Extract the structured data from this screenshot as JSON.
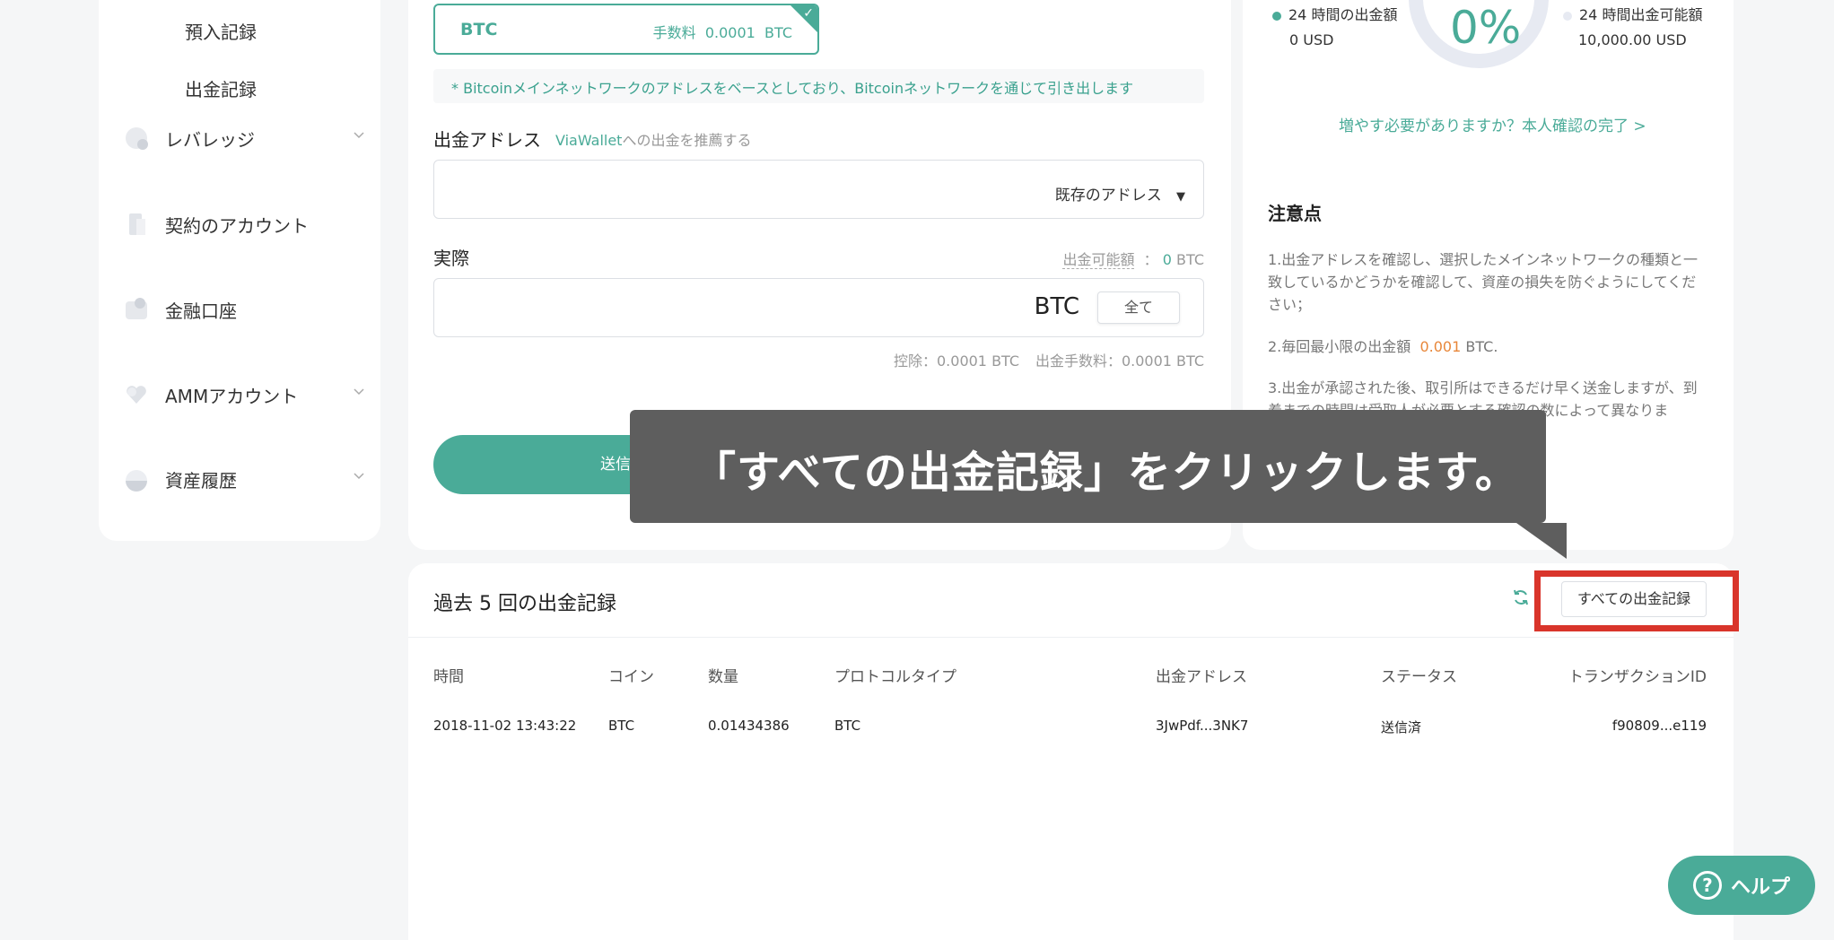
{
  "sidebar": {
    "sub_items": [
      "預入記録",
      "出金記録"
    ],
    "items": [
      {
        "label": "レバレッジ",
        "icon": "leverage-icon"
      },
      {
        "label": "契約のアカウント",
        "icon": "contract-icon"
      },
      {
        "label": "金融口座",
        "icon": "finance-icon"
      },
      {
        "label": "AMMアカウント",
        "icon": "amm-icon"
      },
      {
        "label": "資産履歴",
        "icon": "asset-history-icon"
      }
    ]
  },
  "form": {
    "coin": "BTC",
    "fee_label": "手数料",
    "fee_value": "0.0001",
    "fee_unit": "BTC",
    "network_note": "* Bitcoinメインネットワークのアドレスをベースとしており、Bitcoinネットワークを通じて引き出します",
    "address_label": "出金アドレス",
    "viawallet_link": "ViaWallet",
    "viawallet_suffix": "への出金を推薦する",
    "address_select": "既存のアドレス",
    "actual_label": "実際",
    "available_label": "出金可能額",
    "available_value": "0",
    "available_unit": "BTC",
    "amount_unit": "BTC",
    "all_button": "全て",
    "deduct_text": "控除：0.0001 BTC",
    "withdraw_fee_text": "出金手数料：0.0001 BTC",
    "send_button": "送信する"
  },
  "limits": {
    "left_label": "24 時間の出金額",
    "left_value": "0 USD",
    "right_label": "24 時間出金可能額",
    "right_value": "10,000.00 USD",
    "percent": "0%",
    "percent_value": 0,
    "increase_link": "増やす必要がありますか？本人確認の完了 >"
  },
  "notice": {
    "title": "注意点",
    "p1": "1.出金アドレスを確認し、選択したメインネットワークの種類と一致しているかどうかを確認して、資産の損失を防ぐようにしてください；",
    "p2_prefix": "2.毎回最小限の出金額",
    "p2_value": "0.001",
    "p2_suffix": "BTC.",
    "p3": "3.出金が承認された後、取引所はできるだけ早く送金しますが、到着までの時間は受取人が必要とする確認の数によって異なりま"
  },
  "history": {
    "title": "過去 5 回の出金記録",
    "all_records_button": "すべての出金記録",
    "columns": [
      "時間",
      "コイン",
      "数量",
      "プロトコルタイプ",
      "出金アドレス",
      "ステータス",
      "トランザクションID"
    ],
    "rows": [
      {
        "time": "2018-11-02 13:43:22",
        "coin": "BTC",
        "amount": "0.01434386",
        "protocol": "BTC",
        "address": "3JwPdf...3NK7",
        "status": "送信済",
        "txid": "f90809...e119"
      }
    ]
  },
  "tooltip": {
    "text": "「すべての出金記録」をクリックします。"
  },
  "help": {
    "label": "ヘルプ"
  },
  "colors": {
    "accent": "#4aab98",
    "highlight": "#d9352b",
    "tooltip_bg": "#5e5e5e"
  }
}
